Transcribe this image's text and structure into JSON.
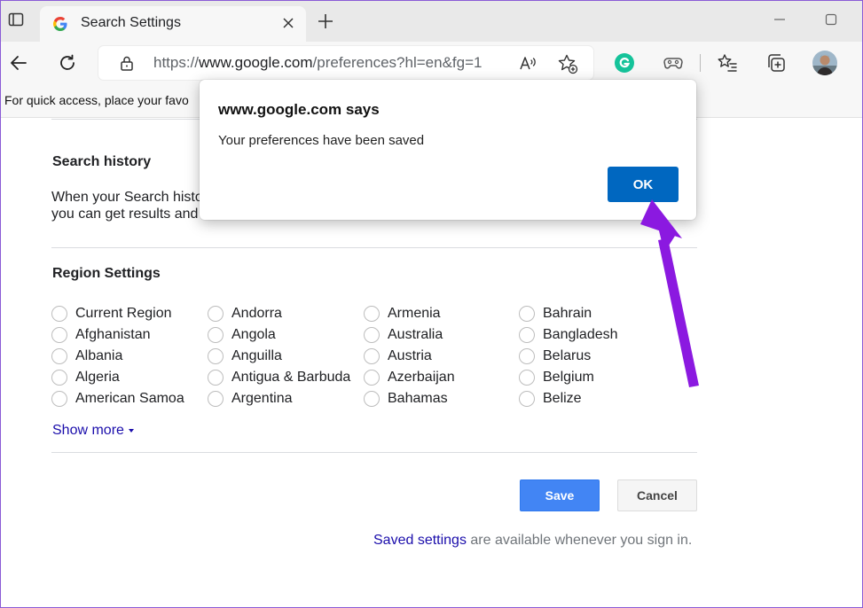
{
  "tab": {
    "title": "Search Settings"
  },
  "toolbar": {
    "url_prefix": "https://",
    "url_host": "www.google.com",
    "url_path": "/preferences?hl=en&fg=1"
  },
  "favorites_bar": {
    "text": "For quick access, place your favo"
  },
  "search_history": {
    "title": "Search history",
    "line1": "When your Search histo",
    "line2": "you can get results and"
  },
  "region": {
    "title": "Region Settings",
    "columns": [
      [
        "Current Region",
        "Afghanistan",
        "Albania",
        "Algeria",
        "American Samoa"
      ],
      [
        "Andorra",
        "Angola",
        "Anguilla",
        "Antigua & Barbuda",
        "Argentina"
      ],
      [
        "Armenia",
        "Australia",
        "Austria",
        "Azerbaijan",
        "Bahamas"
      ],
      [
        "Bahrain",
        "Bangladesh",
        "Belarus",
        "Belgium",
        "Belize"
      ]
    ],
    "show_more": "Show more"
  },
  "buttons": {
    "save": "Save",
    "cancel": "Cancel"
  },
  "saved_note": {
    "link": "Saved settings",
    "rest": " are available whenever you sign in."
  },
  "dialog": {
    "title": "www.google.com says",
    "message": "Your preferences have been saved",
    "ok": "OK"
  },
  "colors": {
    "accent_dialog": "#0067c0",
    "save_button": "#4285f4",
    "link": "#1a0dab",
    "annotation_arrow": "#8b19e0",
    "grammarly": "#15c39a"
  },
  "icons": {
    "sidebar": "sidebar-icon",
    "google": "google-g-icon",
    "close": "close-icon",
    "new_tab": "plus-icon",
    "back": "back-arrow-icon",
    "refresh": "refresh-icon",
    "lock": "lock-icon",
    "read_aloud": "read-aloud-icon",
    "add_favorite": "star-plus-icon",
    "grammarly": "grammarly-icon",
    "games": "gamepad-icon",
    "favorites": "favorites-list-icon",
    "collections": "collections-icon",
    "profile": "avatar"
  }
}
